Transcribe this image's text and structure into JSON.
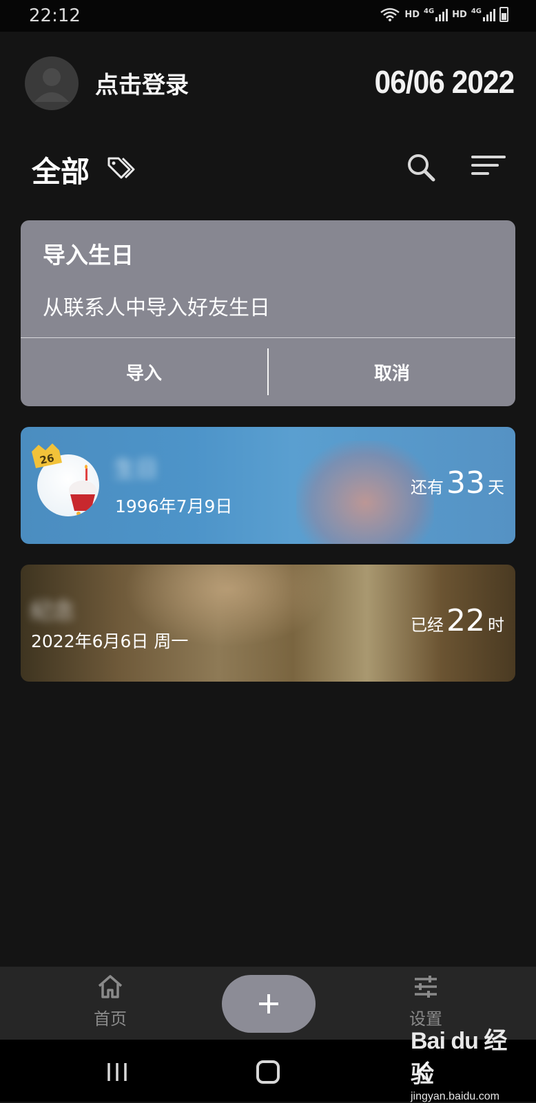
{
  "status_bar": {
    "time": "22:12",
    "sim1": "HD",
    "net1": "4G",
    "sim2": "HD",
    "net2": "4G",
    "icons": [
      "wifi-icon",
      "signal-icon",
      "battery-icon"
    ]
  },
  "header": {
    "login_text": "点击登录",
    "date": "06/06 2022",
    "avatar_icon": "person-icon"
  },
  "filter": {
    "title": "全部",
    "tag_icon": "tag-icon",
    "search_icon": "search-icon",
    "sort_icon": "sort-icon"
  },
  "import_card": {
    "title": "导入生日",
    "description": "从联系人中导入好友生日",
    "import_label": "导入",
    "cancel_label": "取消"
  },
  "events": [
    {
      "name": "生日",
      "date": "1996年7月9日",
      "age_badge": "26",
      "count_prefix": "还有",
      "count_number": "33",
      "count_unit": "天",
      "color": "#4d94c9"
    },
    {
      "name": "纪念",
      "date": "2022年6月6日 周一",
      "count_prefix": "已经",
      "count_number": "22",
      "count_unit": "时",
      "color": "#8e7a56"
    }
  ],
  "bottom_nav": {
    "home_label": "首页",
    "settings_label": "设置",
    "add_icon": "plus-icon"
  },
  "watermark": {
    "logo": "Bai du 经验",
    "url": "jingyan.baidu.com"
  },
  "colors": {
    "background": "#141414",
    "card_gray": "#878791",
    "accent_blue": "#4d94c9"
  }
}
